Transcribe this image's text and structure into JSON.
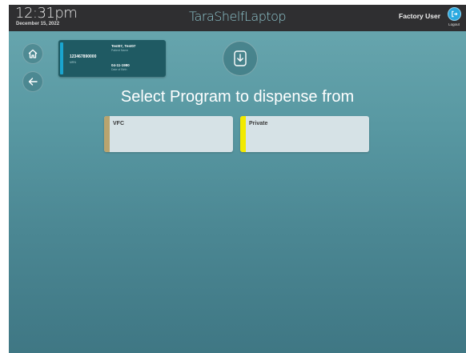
{
  "header": {
    "time": "12:31pm",
    "date": "December 15, 2022",
    "device_name": "TaraShelfLaptop",
    "user_name": "Factory User",
    "logout_label": "Logout"
  },
  "patient": {
    "id": "123467890000",
    "id_sub": "MRN",
    "name": "Test07, Test07",
    "name_label": "Patient Name",
    "dob": "04-11-1980",
    "dob_label": "Date of Birth"
  },
  "main": {
    "title": "Select Program to dispense from",
    "programs": [
      {
        "label": "VFC",
        "color": "#b9a46f"
      },
      {
        "label": "Private",
        "color": "#f2ea00"
      }
    ]
  },
  "colors": {
    "topbar": "#2f2f31",
    "background": "#5898a2",
    "card": "#1f5a63",
    "accent": "#2aa9e0"
  },
  "icons": [
    "home-icon",
    "back-arrow-icon",
    "dispense-icon",
    "logout-icon"
  ]
}
